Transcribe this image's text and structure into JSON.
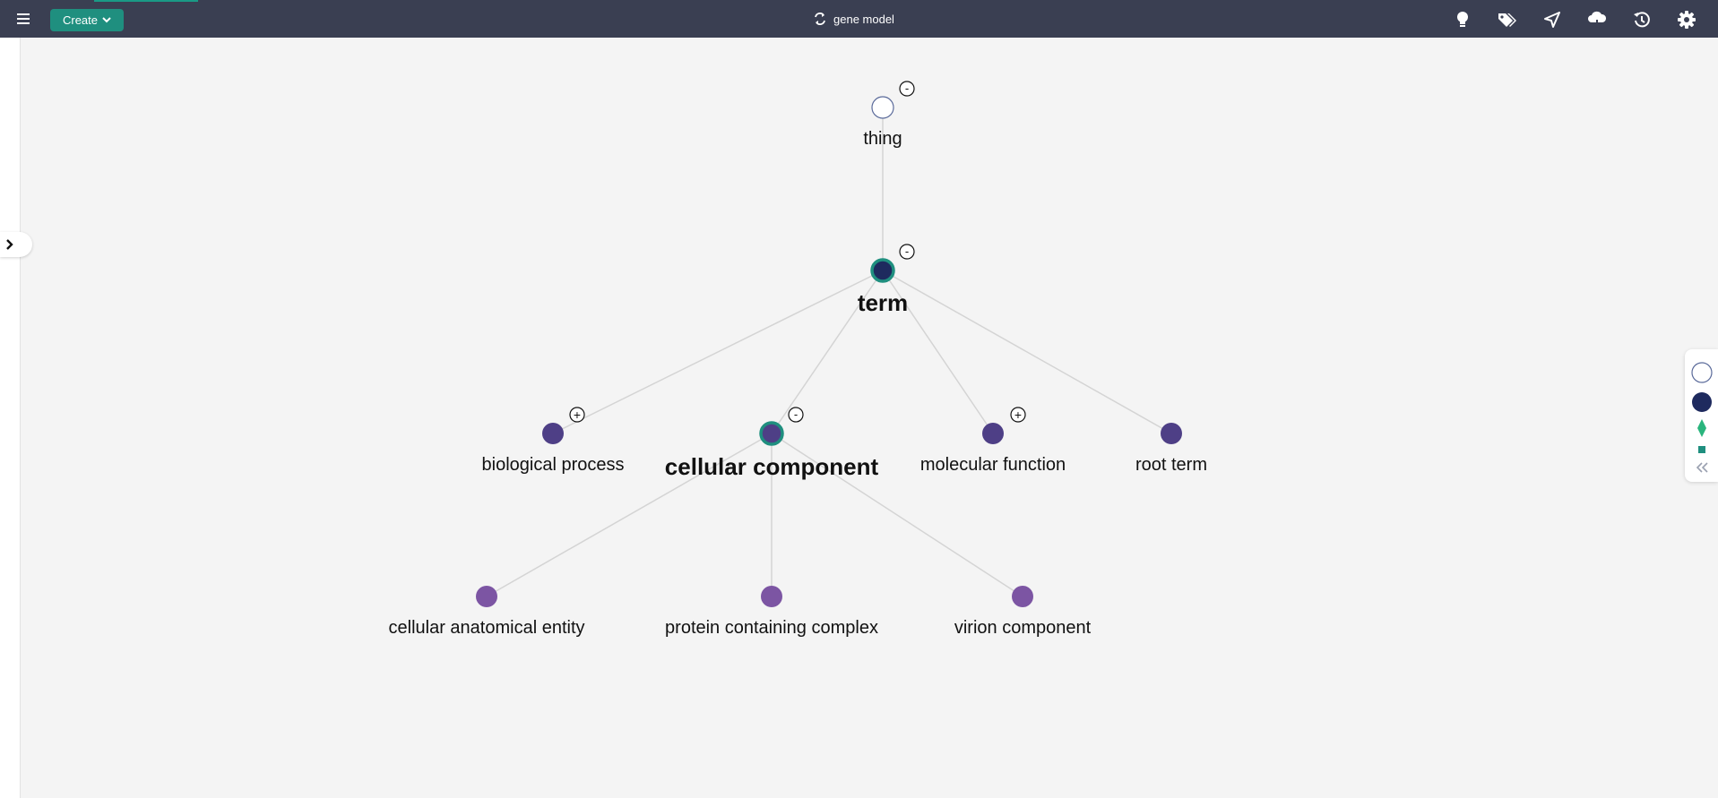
{
  "toolbar": {
    "create_label": "Create",
    "model_title": "gene model",
    "icons": [
      "menu-icon",
      "chevron-down-icon",
      "sync-icon",
      "lightbulb-icon",
      "tags-icon",
      "send-icon",
      "cloud-icon",
      "history-icon",
      "gear-icon"
    ]
  },
  "colors": {
    "topbar": "#3a3f52",
    "accent": "#1f8f7f",
    "node_root": "#ffffff",
    "node_selected": "#1e2a5e",
    "node_level2": "#4e3f86",
    "node_level3": "#7c55a3",
    "edge": "#d4d4d4"
  },
  "graph": {
    "nodes": {
      "thing": "thing",
      "term": "term",
      "biological_process": "biological process",
      "cellular_component": "cellular component",
      "molecular_function": "molecular function",
      "root_term": "root term",
      "cellular_anatomical_entity": "cellular anatomical entity",
      "protein_containing_complex": "protein containing complex",
      "virion_component": "virion component"
    },
    "toggles": {
      "thing": "-",
      "term": "-",
      "biological_process": "+",
      "cellular_component": "-",
      "molecular_function": "+"
    },
    "edges": [
      [
        "thing",
        "term"
      ],
      [
        "term",
        "biological_process"
      ],
      [
        "term",
        "cellular_component"
      ],
      [
        "term",
        "molecular_function"
      ],
      [
        "term",
        "root_term"
      ],
      [
        "cellular_component",
        "cellular_anatomical_entity"
      ],
      [
        "cellular_component",
        "protein_containing_complex"
      ],
      [
        "cellular_component",
        "virion_component"
      ]
    ]
  },
  "legend": {
    "items": [
      "class-hollow-circle-icon",
      "class-filled-circle-icon",
      "property-diamond-icon",
      "datatype-square-icon"
    ],
    "collapse_icon": "double-chevron-left-icon"
  }
}
